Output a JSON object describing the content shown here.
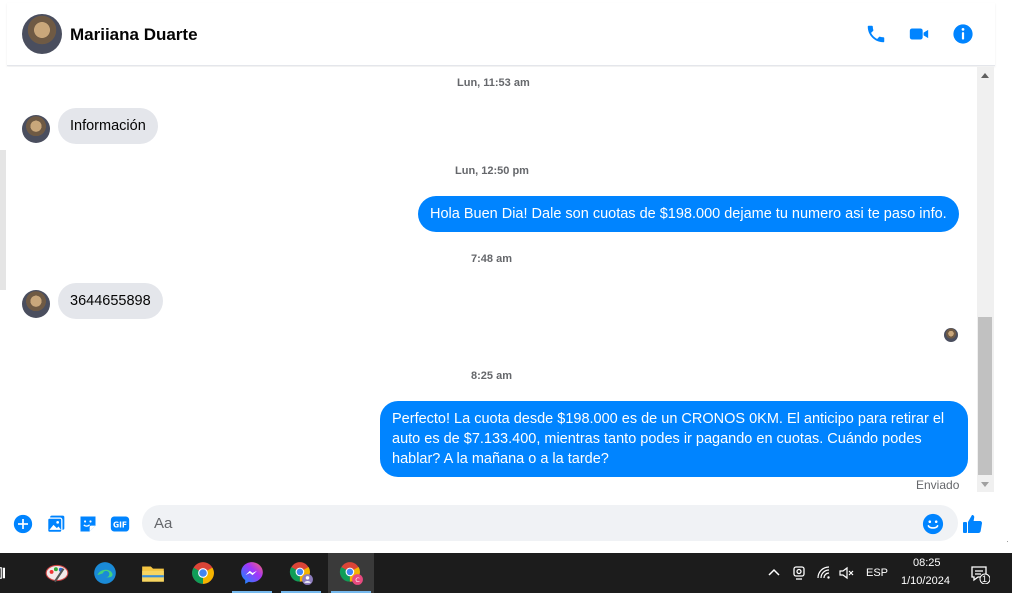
{
  "header": {
    "contact_name": "Mariiana Duarte"
  },
  "messages": [
    {
      "type": "timestamp",
      "text": "Lun, 11:53 am"
    },
    {
      "type": "incoming",
      "text": "Información"
    },
    {
      "type": "timestamp",
      "text": "Lun, 12:50 pm"
    },
    {
      "type": "outgoing",
      "text": "Hola Buen Dia! Dale son cuotas de $198.000 dejame tu numero asi te paso info."
    },
    {
      "type": "timestamp",
      "text": "7:48 am"
    },
    {
      "type": "incoming",
      "text": "3644655898"
    },
    {
      "type": "timestamp",
      "text": "8:25 am"
    },
    {
      "type": "outgoing",
      "text": "Perfecto! La cuota desde $198.000 es de un CRONOS 0KM. El anticipo para retirar el auto es de $7.133.400, mientras tanto podes ir pagando en cuotas. Cuándo podes hablar? A la mañana o a la tarde?"
    }
  ],
  "status": {
    "sent": "Enviado"
  },
  "composer": {
    "placeholder": "Aa"
  },
  "taskbar": {
    "lang": "ESP",
    "time": "08:25",
    "date": "1/10/2024",
    "notification_count": "1"
  },
  "colors": {
    "accent": "#0084ff",
    "incoming_bubble": "#e4e6eb",
    "taskbar": "#1c1c1c"
  }
}
